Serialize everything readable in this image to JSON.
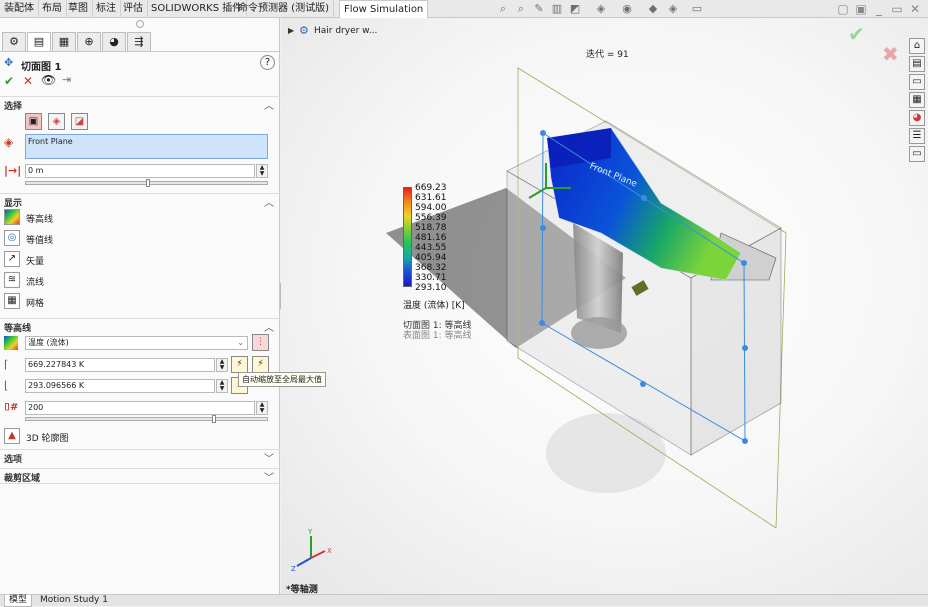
{
  "command_tabs": [
    "装配体",
    "布局",
    "草图",
    "标注",
    "评估",
    "SOLIDWORKS 插件",
    "命令预测器 (测试版)",
    "Flow Simulation"
  ],
  "tree": {
    "item": "Hair dryer w..."
  },
  "panel": {
    "title": "切面图 1",
    "selection": {
      "header": "选择",
      "plane": "Front Plane",
      "offset": "0 m"
    },
    "display": {
      "header": "显示",
      "options": [
        "等高线",
        "等值线",
        "矢量",
        "流线",
        "网格"
      ]
    },
    "contours": {
      "header": "等高线",
      "parameter": "温度 (流体)",
      "max": "669.227843 K",
      "min": "293.096566 K",
      "levels": "200",
      "tooltip": "自动缩放至全局最大值",
      "profile_3d": "3D 轮廓图"
    },
    "options_header": "选项",
    "clip_header": "裁剪区域"
  },
  "viewport": {
    "iteration": "迭代 = 91",
    "legend": {
      "ticks": [
        "669.23",
        "631.61",
        "594.00",
        "556.39",
        "518.78",
        "481.16",
        "443.55",
        "405.94",
        "368.32",
        "330.71",
        "293.10"
      ],
      "title": "温度 (流体) [K]",
      "line1": "切面图 1: 等高线",
      "line2": "表面图 1: 等高线"
    },
    "view_label": "*等轴测",
    "plane_label": "Front Plane"
  },
  "bottom_tabs": [
    "模型",
    "Motion Study 1"
  ]
}
